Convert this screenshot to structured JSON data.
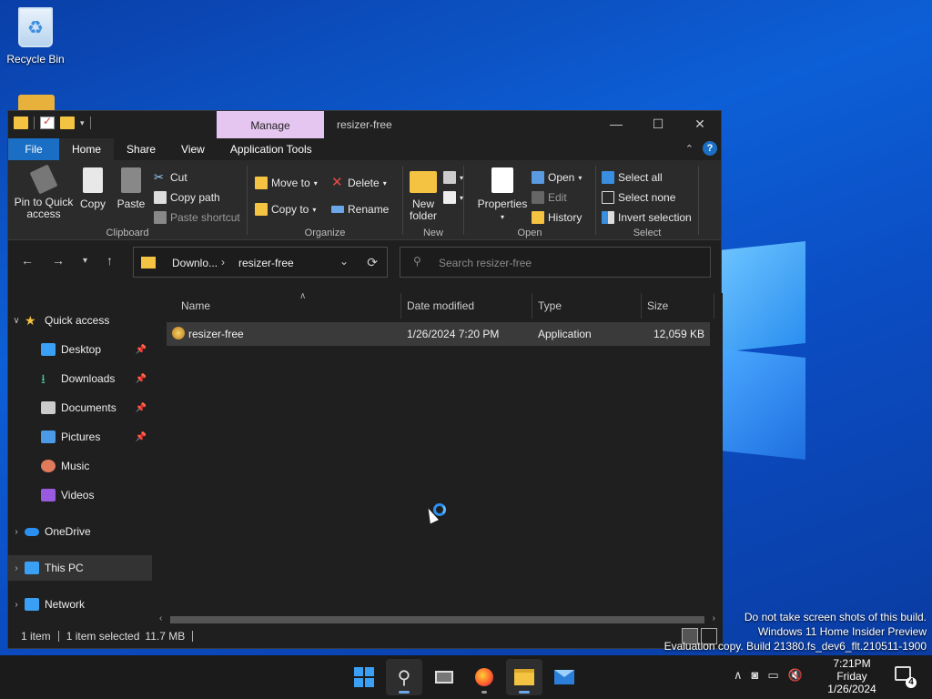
{
  "desktop": {
    "recycle_bin_label": "Recycle Bin",
    "watermark": [
      "Do not take screen shots of this build.",
      "Windows 11 Home Insider Preview",
      "Evaluation copy. Build 21380.fs_dev6_flt.210511-1900"
    ]
  },
  "window": {
    "title": "resizer-free",
    "manage_tab": "Manage",
    "controls": {
      "minimize": "—",
      "maximize": "☐",
      "close": "✕"
    }
  },
  "ribbon_tabs": {
    "file": "File",
    "home": "Home",
    "share": "Share",
    "view": "View",
    "app_tools": "Application Tools",
    "collapse": "⌃",
    "help": "?"
  },
  "ribbon": {
    "clipboard": {
      "name": "Clipboard",
      "pin": "Pin to Quick access",
      "copy": "Copy",
      "paste": "Paste",
      "cut": "Cut",
      "copy_path": "Copy path",
      "paste_shortcut": "Paste shortcut"
    },
    "organize": {
      "name": "Organize",
      "move_to": "Move to",
      "copy_to": "Copy to",
      "delete": "Delete",
      "rename": "Rename"
    },
    "new": {
      "name": "New",
      "new_folder": "New folder"
    },
    "open": {
      "name": "Open",
      "properties": "Properties",
      "open": "Open",
      "edit": "Edit",
      "history": "History"
    },
    "select": {
      "name": "Select",
      "select_all": "Select all",
      "select_none": "Select none",
      "invert": "Invert selection"
    }
  },
  "address": {
    "crumb1": "Downlo...",
    "crumb2": "resizer-free",
    "search_placeholder": "Search resizer-free"
  },
  "nav": {
    "quick_access": "Quick access",
    "desktop": "Desktop",
    "downloads": "Downloads",
    "documents": "Documents",
    "pictures": "Pictures",
    "music": "Music",
    "videos": "Videos",
    "onedrive": "OneDrive",
    "this_pc": "This PC",
    "network": "Network"
  },
  "columns": {
    "name": "Name",
    "date": "Date modified",
    "type": "Type",
    "size": "Size"
  },
  "file": {
    "name": "resizer-free",
    "date": "1/26/2024 7:20 PM",
    "type": "Application",
    "size": "12,059 KB"
  },
  "status": {
    "count": "1 item",
    "selected": "1 item selected",
    "size": "11.7 MB"
  },
  "taskbar": {
    "time": "7:21PM",
    "day": "Friday",
    "date": "1/26/2024",
    "notifications": "4"
  }
}
